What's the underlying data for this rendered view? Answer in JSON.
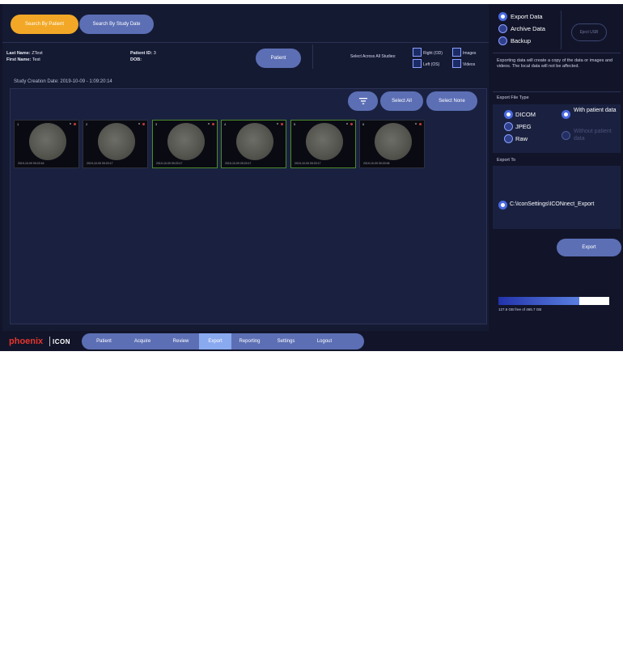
{
  "search_tabs": {
    "by_patient": "Search By Patient",
    "by_date": "Search By Study Date"
  },
  "patient": {
    "last_name_label": "Last Name:",
    "last_name": "ZTest",
    "first_name_label": "First Name:",
    "first_name": "Test",
    "id_label": "Patient ID:",
    "id": "3",
    "dob_label": "DOB:",
    "dob": "",
    "button_label": "Patient"
  },
  "filters": {
    "select_across": "Select Across All Studies:",
    "right_od": "Right (OD)",
    "left_os": "Left (OS)",
    "images": "Images",
    "videos": "Videos"
  },
  "study": {
    "creation_date": "Study Creation Date: 2019-10-09 - 1:09:20:14",
    "select_all": "Select All",
    "select_none": "Select None",
    "thumbnails": [
      {
        "index": "1",
        "timestamp": "2019-10-09 09:20:16",
        "selected": false
      },
      {
        "index": "2",
        "timestamp": "2019-10-09 09:20:17",
        "selected": false
      },
      {
        "index": "3",
        "timestamp": "2019-10-09 09:20:17",
        "selected": true
      },
      {
        "index": "4",
        "timestamp": "2019-10-09 09:20:17",
        "selected": true
      },
      {
        "index": "5",
        "timestamp": "2019-10-09 09:20:17",
        "selected": true
      },
      {
        "index": "6",
        "timestamp": "2019-10-09 09:20:06",
        "selected": false
      }
    ]
  },
  "right_panel": {
    "mode_options": [
      "Export Data",
      "Archive Data",
      "Backup"
    ],
    "mode_selected": "Export Data",
    "eject_label": "Eject USB",
    "export_description": "Exporting data will create a copy of the data or images and videos. The local data will not be affected.",
    "file_type_label": "Export File Type",
    "file_types": [
      "DICOM",
      "JPEG",
      "Raw"
    ],
    "file_type_selected": "DICOM",
    "patient_data_with": "With patient data",
    "patient_data_without": "Without patient data",
    "export_to_label": "Export To",
    "export_path": "C:\\IconSettings\\ICONnect_Export",
    "export_button": "Export",
    "storage_text": "127.6 GB free of 465.7 GB",
    "storage_used_fraction": 0.73
  },
  "nav": {
    "brand": "phoenix",
    "brand_product": "ICON",
    "items": [
      "Patient",
      "Acquire",
      "Review",
      "Export",
      "Reporting",
      "Settings",
      "Logout"
    ],
    "active": "Export"
  },
  "colors": {
    "accent": "#f2a826",
    "button": "#5c6fb5",
    "active_nav": "#8aaaf0",
    "brand_red": "#e5352c"
  }
}
